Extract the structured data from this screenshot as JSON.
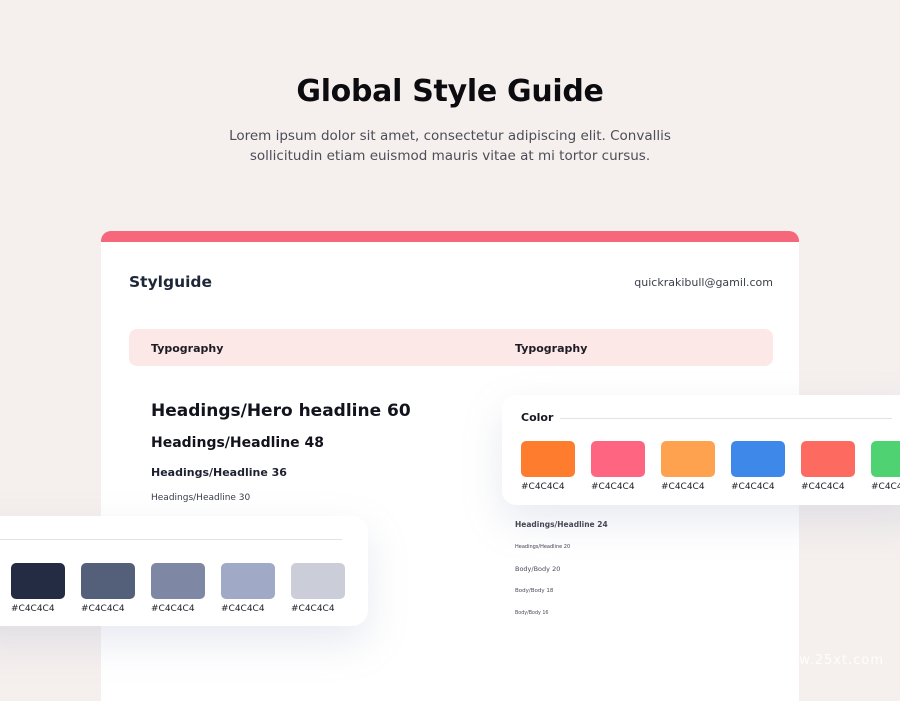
{
  "hero": {
    "title": "Global Style Guide",
    "subtitle_line1": "Lorem ipsum dolor sit amet, consectetur adipiscing elit. Convallis",
    "subtitle_line2": "sollicitudin etiam euismod mauris vitae at mi tortor cursus."
  },
  "card": {
    "accent_color": "#f6677c",
    "brand": "Stylguide",
    "email": "quickrakibull@gamil.com",
    "typography_left": "Typography",
    "typography_right": "Typography",
    "headings_left": [
      "Headings/Hero headline 60",
      "Headings/Headline 48",
      "Headings/Headline 36",
      "Headings/Headline 30"
    ],
    "headings_right": [
      "Headings/Headline 24",
      "Headings/Headline 20",
      "Body/Body 20",
      "Body/Body 18",
      "Body/Body 16"
    ]
  },
  "color_panel": {
    "label": "Color",
    "swatches": [
      {
        "color": "#fe7c2e",
        "label": "#C4C4C4"
      },
      {
        "color": "#fe6580",
        "label": "#C4C4C4"
      },
      {
        "color": "#fea24f",
        "label": "#C4C4C4"
      },
      {
        "color": "#3e88ea",
        "label": "#C4C4C4"
      },
      {
        "color": "#fd6a5f",
        "label": "#C4C4C4"
      },
      {
        "color": "#4fd272",
        "label": "#C4C4"
      }
    ]
  },
  "neutral_panel": {
    "swatches": [
      {
        "color": "#232c42",
        "label": "#C4C4C4"
      },
      {
        "color": "#545f79",
        "label": "#C4C4C4"
      },
      {
        "color": "#7e87a3",
        "label": "#C4C4C4"
      },
      {
        "color": "#a0aac7",
        "label": "#C4C4C4"
      },
      {
        "color": "#cbced9",
        "label": "#C4C4C4"
      }
    ]
  },
  "watermark": "www.25xt.com"
}
